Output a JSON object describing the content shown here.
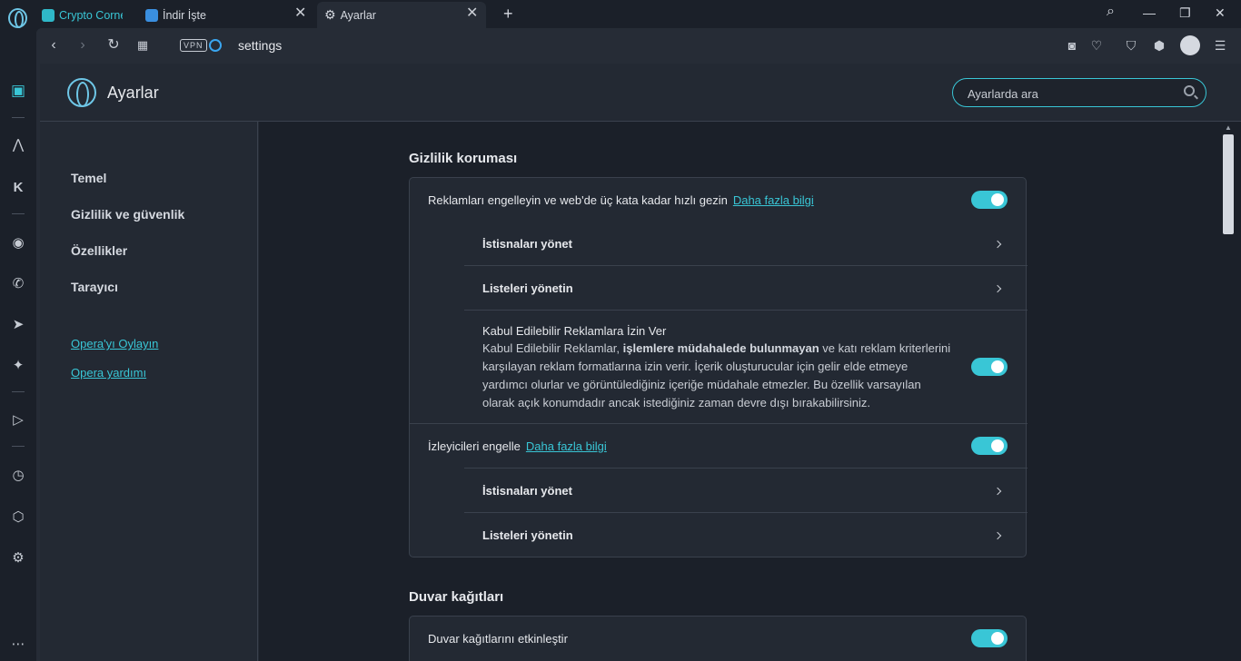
{
  "tabs": [
    {
      "label": "Crypto Corne",
      "fav_color": "#2fb8c8"
    },
    {
      "label": "İndir İşte",
      "fav_color": "#3a8fe0"
    },
    {
      "label": "Ayarlar",
      "active": true
    }
  ],
  "address": {
    "vpn_label": "VPN",
    "url": "settings"
  },
  "header": {
    "title": "Ayarlar",
    "search_placeholder": "Ayarlarda ara"
  },
  "nav": {
    "items": [
      "Temel",
      "Gizlilik ve güvenlik",
      "Özellikler",
      "Tarayıcı"
    ],
    "links": [
      "Opera'yı Oylayın",
      "Opera yardımı"
    ]
  },
  "privacy": {
    "title": "Gizlilik koruması",
    "ads_label": "Reklamları engelleyin ve web'de üç kata kadar hızlı gezin",
    "ads_learn_more": "Daha fazla bilgi",
    "ads_exceptions": "İstisnaları yönet",
    "ads_lists": "Listeleri yönetin",
    "acceptable_title": "Kabul Edilebilir Reklamlara İzin Ver",
    "acceptable_desc_pre": "Kabul Edilebilir Reklamlar,",
    "acceptable_desc_bold": "işlemlere müdahalede bulunmayan",
    "acceptable_desc_post": "ve katı reklam kriterlerini karşılayan reklam formatlarına izin verir. İçerik oluşturucular için gelir elde etmeye yardımcı olurlar ve görüntülediğiniz içeriğe müdahale etmezler. Bu özellik varsayılan olarak açık konumdadır ancak istediğiniz zaman devre dışı bırakabilirsiniz.",
    "trackers_label": "İzleyicileri engelle",
    "trackers_learn_more": "Daha fazla bilgi",
    "trackers_exceptions": "İstisnaları yönet",
    "trackers_lists": "Listeleri yönetin"
  },
  "wallpapers": {
    "title": "Duvar kağıtları",
    "enable_label": "Duvar kağıtlarını etkinleştir"
  },
  "colors": {
    "accent": "#39c6d6",
    "bg": "#1b2029",
    "card": "#232933"
  }
}
